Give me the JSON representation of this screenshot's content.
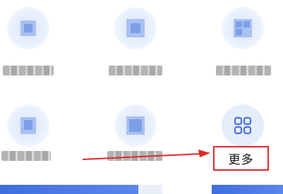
{
  "grid": {
    "items": [
      {
        "label": "",
        "blurred": true
      },
      {
        "label": "",
        "blurred": true
      },
      {
        "label": "",
        "blurred": true
      },
      {
        "label": "",
        "blurred": true
      },
      {
        "label": "",
        "blurred": true
      },
      {
        "label": "更多",
        "blurred": false,
        "icon": "grid-four-squares-icon"
      }
    ]
  },
  "annotation": {
    "highlight_color": "#e02a2a",
    "arrow_color": "#e02a2a"
  },
  "colors": {
    "accent": "#4a72e0",
    "icon_bubble": "#e6eefc"
  }
}
